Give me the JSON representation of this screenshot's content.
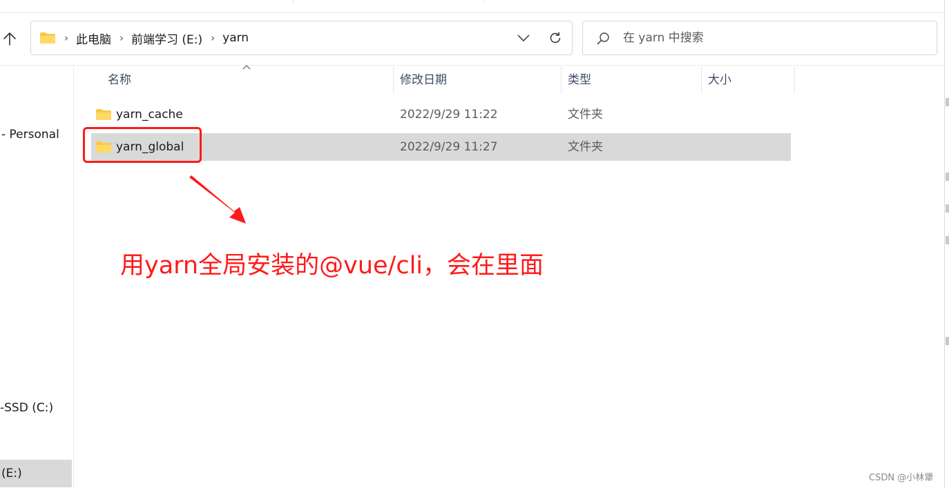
{
  "breadcrumb": {
    "items": [
      "此电脑",
      "前端学习 (E:)",
      "yarn"
    ]
  },
  "search": {
    "placeholder": "在 yarn 中搜索"
  },
  "columns": {
    "name": "名称",
    "modified": "修改日期",
    "type": "类型",
    "size": "大小"
  },
  "files": [
    {
      "name": "yarn_cache",
      "modified": "2022/9/29 11:22",
      "type": "文件夹",
      "size": ""
    },
    {
      "name": "yarn_global",
      "modified": "2022/9/29 11:27",
      "type": "文件夹",
      "size": ""
    }
  ],
  "nav": {
    "items": [
      "- Personal",
      "-SSD (C:)",
      "(E:)"
    ]
  },
  "annotation": {
    "text": "用yarn全局安装的@vue/cli，会在里面"
  },
  "watermark": "CSDN @小林犟",
  "colors": {
    "annotation": "#ff1a1a",
    "selection": "#d9d9d9",
    "folder": "#f7c948",
    "header_text": "#3d4b66"
  },
  "icons": [
    "up-arrow-icon",
    "folder-icon",
    "chevron-right-icon",
    "chevron-down-icon",
    "refresh-icon",
    "search-icon",
    "sort-up-icon"
  ]
}
